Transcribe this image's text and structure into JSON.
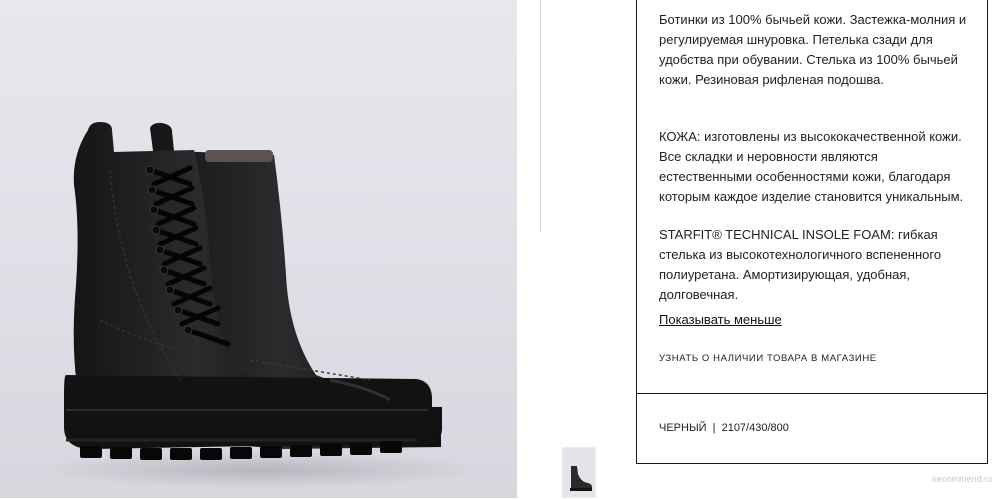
{
  "product": {
    "description_1": "Ботинки из 100% бычьей кожи. Застежка-молния и регулируемая шнуровка. Петелька сзади для удобства при обувании. Стелька из 100% бычьей кожи. Резиновая рифленая подошва.",
    "description_2": "КОЖА: изготовлены из высококачественной кожи. Все складки и неровности являются естественными особенностями кожи, благодаря которым каждое изделие становится уникальным.",
    "description_3": "STARFIT® TECHNICAL INSOLE FOAM: гибкая стелька из высокотехнологичного вспененного полиуретана. Амортизирующая, удобная, долговечная.",
    "show_less_label": "Показывать меньше",
    "store_availability_label": "УЗНАТЬ О НАЛИЧИИ ТОВАРА В МАГАЗИНЕ",
    "color_name": "ЧЕРНЫЙ",
    "separator": "|",
    "reference": "2107/430/800"
  },
  "watermark": "irecommend.ru",
  "colors": {
    "image_bg": "#e3e4ea",
    "boot": "#1b1b1c",
    "border": "#1a1a1a"
  }
}
